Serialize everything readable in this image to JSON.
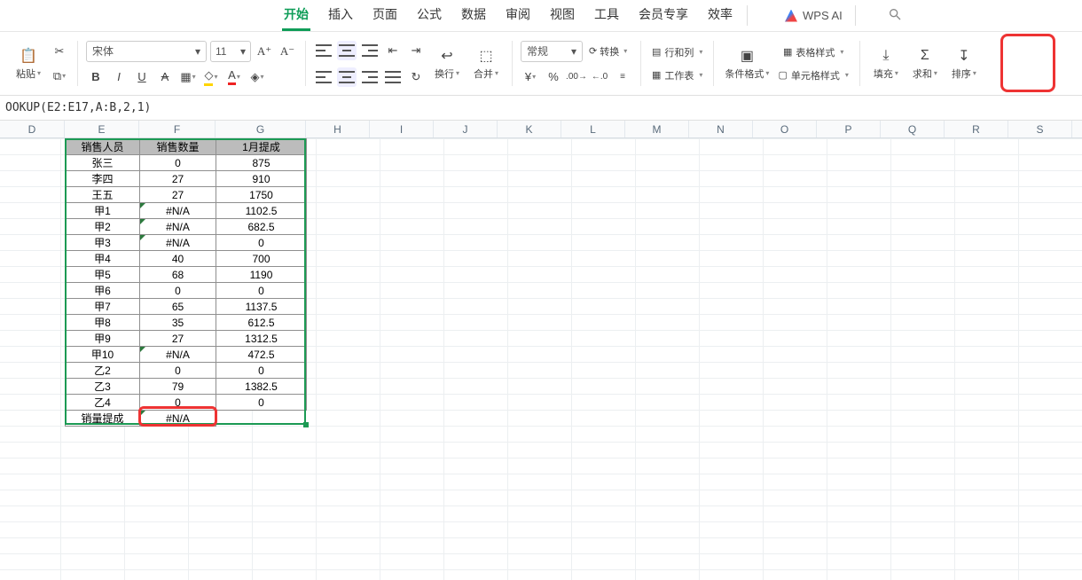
{
  "menu": {
    "tabs": [
      "开始",
      "插入",
      "页面",
      "公式",
      "数据",
      "审阅",
      "视图",
      "工具",
      "会员专享",
      "效率"
    ],
    "active": 0,
    "ai_label": "WPS AI"
  },
  "toolbar": {
    "paste": "粘贴",
    "font_name": "宋体",
    "font_size": "11",
    "wrap": "换行",
    "merge": "合并",
    "number_format": "常规",
    "convert": "转换",
    "rows_cols": "行和列",
    "worksheet": "工作表",
    "cond_format": "条件格式",
    "table_style": "表格样式",
    "cell_style": "单元格样式",
    "fill": "填充",
    "sum": "求和",
    "sort": "排序"
  },
  "formula_bar": "OOKUP(E2:E17,A:B,2,1)",
  "columns": [
    "D",
    "E",
    "F",
    "G",
    "H",
    "I",
    "J",
    "K",
    "L",
    "M",
    "N",
    "O",
    "P",
    "Q",
    "R",
    "S"
  ],
  "table": {
    "headers": [
      "销售人员",
      "销售数量",
      "1月提成"
    ],
    "rows": [
      {
        "e": "张三",
        "f": "0",
        "g": "875",
        "tri": false
      },
      {
        "e": "李四",
        "f": "27",
        "g": "910",
        "tri": false
      },
      {
        "e": "王五",
        "f": "27",
        "g": "1750",
        "tri": false
      },
      {
        "e": "甲1",
        "f": "#N/A",
        "g": "1102.5",
        "tri": true
      },
      {
        "e": "甲2",
        "f": "#N/A",
        "g": "682.5",
        "tri": true
      },
      {
        "e": "甲3",
        "f": "#N/A",
        "g": "0",
        "tri": true
      },
      {
        "e": "甲4",
        "f": "40",
        "g": "700",
        "tri": false
      },
      {
        "e": "甲5",
        "f": "68",
        "g": "1190",
        "tri": false
      },
      {
        "e": "甲6",
        "f": "0",
        "g": "0",
        "tri": false
      },
      {
        "e": "甲7",
        "f": "65",
        "g": "1137.5",
        "tri": false
      },
      {
        "e": "甲8",
        "f": "35",
        "g": "612.5",
        "tri": false
      },
      {
        "e": "甲9",
        "f": "27",
        "g": "1312.5",
        "tri": false
      },
      {
        "e": "甲10",
        "f": "#N/A",
        "g": "472.5",
        "tri": true
      },
      {
        "e": "乙2",
        "f": "0",
        "g": "0",
        "tri": false
      },
      {
        "e": "乙3",
        "f": "79",
        "g": "1382.5",
        "tri": false
      },
      {
        "e": "乙4",
        "f": "0",
        "g": "0",
        "tri": false
      }
    ],
    "footer": {
      "e": "销量提成",
      "f": "#N/A",
      "g": ""
    }
  }
}
